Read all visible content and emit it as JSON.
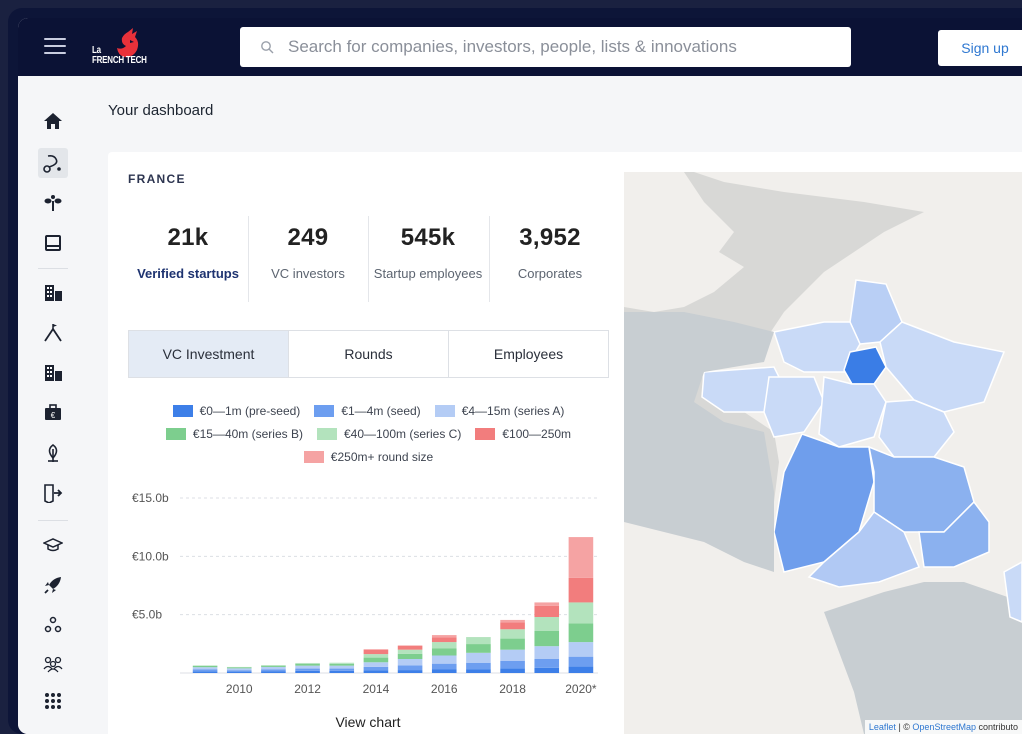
{
  "header": {
    "logo_line1": "La",
    "logo_line2": "FRENCH TECH",
    "search_placeholder": "Search for companies, investors, people, lists & innovations",
    "signup_label": "Sign up"
  },
  "sidebar": {
    "items": [
      {
        "icon": "home-icon"
      },
      {
        "icon": "discover-icon",
        "active": true
      },
      {
        "icon": "seedling-icon"
      },
      {
        "icon": "book-icon"
      },
      {
        "icon": "building-icon"
      },
      {
        "icon": "summit-icon"
      },
      {
        "icon": "building-icon"
      },
      {
        "icon": "briefcase-icon"
      },
      {
        "icon": "leaf-icon"
      },
      {
        "icon": "exit-icon"
      },
      {
        "icon": "graduation-cap-icon"
      },
      {
        "icon": "rocket-icon"
      },
      {
        "icon": "network-icon"
      },
      {
        "icon": "people-icon"
      },
      {
        "icon": "apps-grid-icon"
      }
    ]
  },
  "page": {
    "title": "Your dashboard"
  },
  "summary": {
    "country": "FRANCE",
    "stats": [
      {
        "value": "21k",
        "label": "Verified startups"
      },
      {
        "value": "249",
        "label": "VC investors"
      },
      {
        "value": "545k",
        "label": "Startup employees"
      },
      {
        "value": "3,952",
        "label": "Corporates"
      }
    ]
  },
  "tabs": [
    {
      "label": "VC Investment",
      "active": true
    },
    {
      "label": "Rounds",
      "active": false
    },
    {
      "label": "Employees",
      "active": false
    }
  ],
  "view_chart_label": "View chart",
  "map": {
    "attribution_leaflet": "Leaflet",
    "attribution_sep": " | © ",
    "attribution_osm": "OpenStreetMap",
    "attribution_rest": " contributo"
  },
  "colors": {
    "accent": "#2f78d1",
    "header": "#0b1235",
    "active_tab": "#e4ebf5"
  },
  "chart_data": {
    "type": "bar",
    "stacked": true,
    "categories": [
      "2009",
      "2010",
      "2011",
      "2012",
      "2013",
      "2014",
      "2015",
      "2016",
      "2017",
      "2018",
      "2019",
      "2020*"
    ],
    "x_tick_labels": [
      "2010",
      "2012",
      "2014",
      "2016",
      "2018",
      "2020*"
    ],
    "y_tick_labels": [
      "€5.0b",
      "€10.0b",
      "€15.0b"
    ],
    "y_ticks": [
      5,
      10,
      15
    ],
    "ylim": [
      0,
      15
    ],
    "grid": true,
    "legend_position": "top",
    "series": [
      {
        "name": "€0—1m (pre-seed)",
        "color": "#3d7fe8",
        "values": [
          0.15,
          0.12,
          0.16,
          0.18,
          0.18,
          0.22,
          0.25,
          0.3,
          0.33,
          0.4,
          0.45,
          0.55
        ]
      },
      {
        "name": "€1—4m (seed)",
        "color": "#6d9ef0",
        "values": [
          0.15,
          0.12,
          0.16,
          0.2,
          0.2,
          0.3,
          0.4,
          0.5,
          0.55,
          0.65,
          0.75,
          0.85
        ]
      },
      {
        "name": "€4—15m (series A)",
        "color": "#b4ccf5",
        "values": [
          0.2,
          0.16,
          0.2,
          0.25,
          0.25,
          0.4,
          0.55,
          0.7,
          0.85,
          0.95,
          1.1,
          1.25
        ]
      },
      {
        "name": "€15—40m (series B)",
        "color": "#7dce8e",
        "values": [
          0.1,
          0.08,
          0.1,
          0.15,
          0.15,
          0.4,
          0.45,
          0.6,
          0.75,
          0.95,
          1.3,
          1.6
        ]
      },
      {
        "name": "€40—100m (series C)",
        "color": "#b3e3bd",
        "values": [
          0.05,
          0.04,
          0.06,
          0.08,
          0.1,
          0.3,
          0.35,
          0.55,
          0.6,
          0.8,
          1.2,
          1.8
        ]
      },
      {
        "name": "€100—250m",
        "color": "#f27d7d",
        "values": [
          0,
          0,
          0,
          0,
          0,
          0.4,
          0.35,
          0.4,
          0,
          0.6,
          0.95,
          2.1
        ]
      },
      {
        "name": "€250m+ round size",
        "color": "#f5a3a3",
        "values": [
          0,
          0,
          0,
          0,
          0,
          0,
          0,
          0.2,
          0,
          0.2,
          0.3,
          3.5
        ]
      }
    ]
  }
}
